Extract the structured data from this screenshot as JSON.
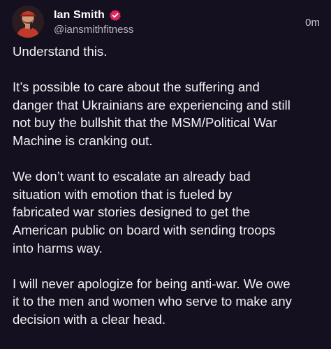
{
  "author": {
    "display_name": "Ian Smith",
    "handle": "@iansmithfitness",
    "avatar_icon": "profile-photo",
    "verified_icon": "verified-badge-icon",
    "verified_color": "#e0245e"
  },
  "post": {
    "timestamp": "0m",
    "paragraphs": [
      "Understand this.",
      "It’s possible to care about the suffering and\ndanger that Ukrainians are experiencing and still\nnot buy the bullshit that the MSM/Political War\nMachine is cranking out.",
      "We don’t want to escalate an already bad\nsituation with emotion that is fueled by\nfabricated war stories designed to get the\nAmerican public on board with sending troops\ninto harms way.",
      "I will never apologize for being anti-war. We owe\nit to the men and women who serve to make any\ndecision with a clear head."
    ]
  },
  "theme": {
    "background": "#15101f",
    "text": "#f1f0f4",
    "muted": "#b9b6c2"
  }
}
